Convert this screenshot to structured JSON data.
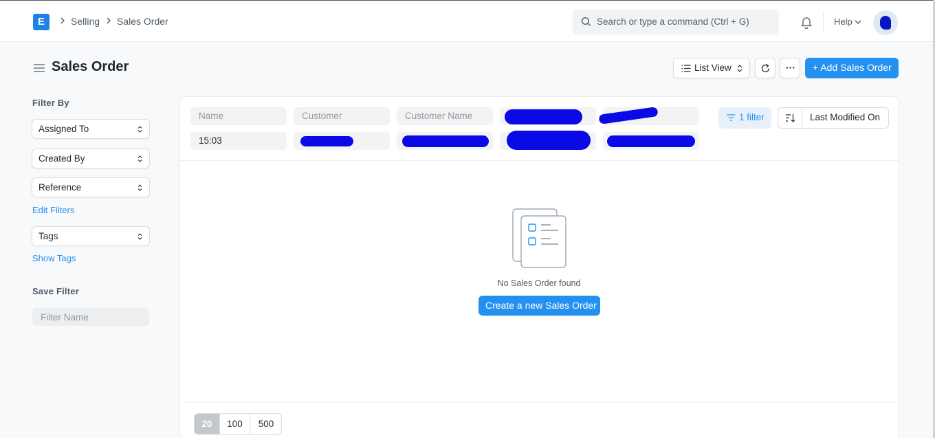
{
  "navbar": {
    "logo_letter": "E",
    "breadcrumbs": [
      "Selling",
      "Sales Order"
    ],
    "search_placeholder": "Search or type a command (Ctrl + G)",
    "help_label": "Help"
  },
  "page": {
    "title": "Sales Order",
    "list_view_label": "List View",
    "more_label": "···",
    "add_button_label": "+ Add Sales Order"
  },
  "sidebar": {
    "filter_by_heading": "Filter By",
    "filters": [
      "Assigned To",
      "Created By",
      "Reference"
    ],
    "edit_filters_link": "Edit Filters",
    "tags_label": "Tags",
    "show_tags_link": "Show Tags",
    "save_filter_heading": "Save Filter",
    "filter_name_placeholder": "Filter Name"
  },
  "list": {
    "standard_filters": {
      "name_placeholder": "Name",
      "customer_placeholder": "Customer",
      "customer_name_placeholder": "Customer Name",
      "time_value": "15:03"
    },
    "filter_button_label": "1 filter",
    "sort_label": "Last Modified On",
    "empty_message": "No Sales Order found",
    "create_button_label": "Create a new Sales Order",
    "page_sizes": [
      "20",
      "100",
      "500"
    ],
    "active_page_size": "20"
  },
  "colors": {
    "primary": "#2490ef",
    "redaction": "#0a0ae6"
  }
}
